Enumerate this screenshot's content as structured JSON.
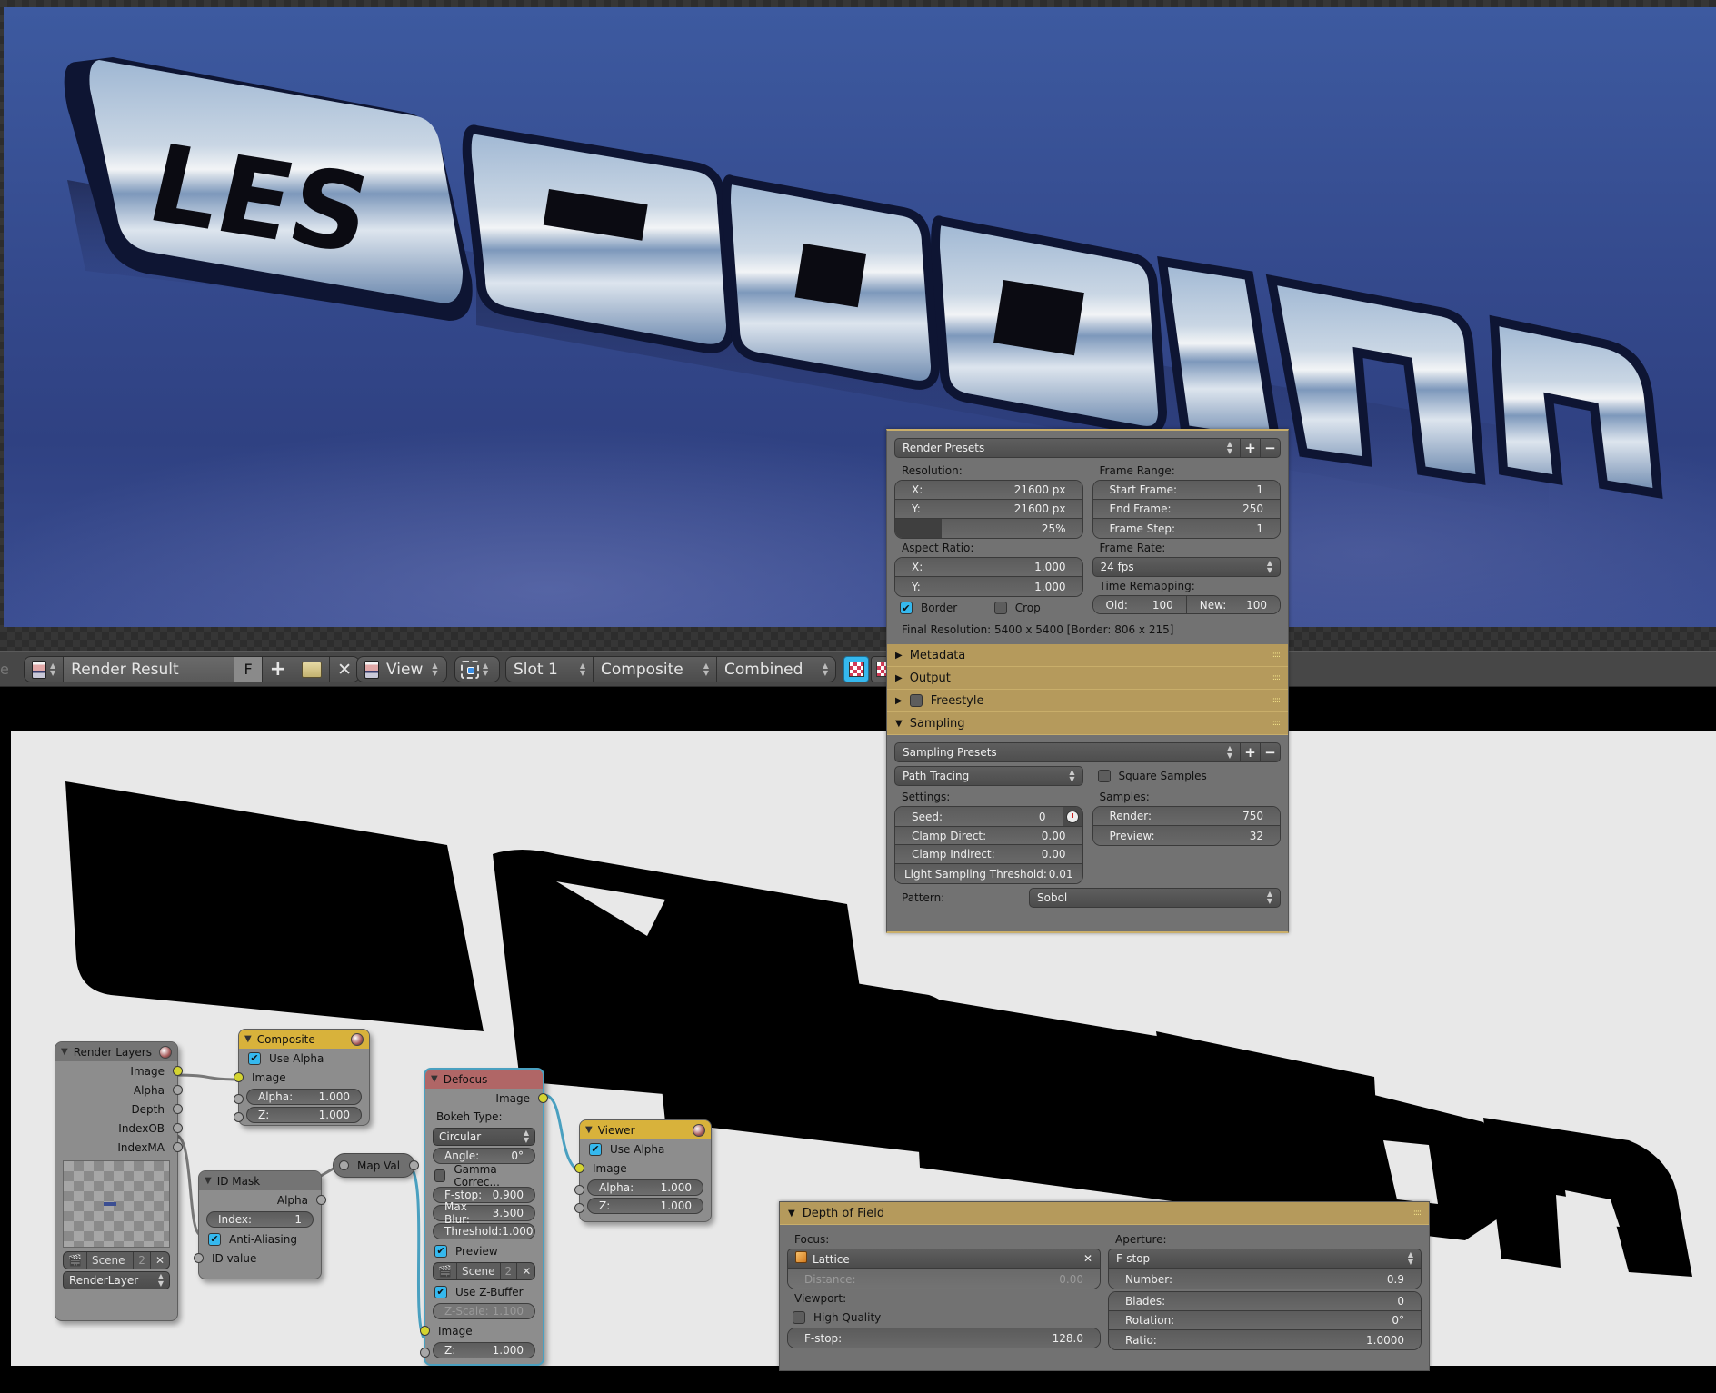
{
  "render_view": {
    "image_content": "LES GAGNON chrome 3D lettering on blue background",
    "text_depicted": "LES GAGNON"
  },
  "toolbar": {
    "cut_label": "e",
    "image_name": "Render Result",
    "fake_user": "F",
    "new_icon": "+",
    "open_icon": "open-folder",
    "close_icon": "✕",
    "view_menu": "View",
    "slot": "Slot 1",
    "layer": "Composite",
    "pass": "Combined",
    "up_down": [
      "▲",
      "▼"
    ]
  },
  "render_panel": {
    "presets_label": "Render Presets",
    "add": "+",
    "remove": "−",
    "resolution_label": "Resolution:",
    "res_x_label": "X:",
    "res_x_value": "21600 px",
    "res_y_label": "Y:",
    "res_y_value": "21600 px",
    "res_percent": "25%",
    "res_percent_fraction": 0.25,
    "aspect_label": "Aspect Ratio:",
    "aspect_x_label": "X:",
    "aspect_x_value": "1.000",
    "aspect_y_label": "Y:",
    "aspect_y_value": "1.000",
    "border_label": "Border",
    "border_checked": true,
    "crop_label": "Crop",
    "crop_checked": false,
    "frame_range_label": "Frame Range:",
    "start_frame_label": "Start Frame:",
    "start_frame_value": "1",
    "end_frame_label": "End Frame:",
    "end_frame_value": "250",
    "frame_step_label": "Frame Step:",
    "frame_step_value": "1",
    "frame_rate_label": "Frame Rate:",
    "frame_rate_value": "24 fps",
    "time_remap_label": "Time Remapping:",
    "old_label": "Old:",
    "old_value": "100",
    "new_label": "New:",
    "new_value": "100",
    "final_resolution": "Final Resolution: 5400 x 5400 [Border: 806 x 215]",
    "sections": [
      {
        "label": "Metadata",
        "expanded": false
      },
      {
        "label": "Output",
        "expanded": false
      },
      {
        "label": "Freestyle",
        "expanded": false,
        "has_checkbox": true
      },
      {
        "label": "Sampling",
        "expanded": true
      }
    ],
    "grip": "::::",
    "sampling": {
      "presets_label": "Sampling Presets",
      "integrator": "Path Tracing",
      "square_samples_label": "Square Samples",
      "square_samples_checked": false,
      "settings_label": "Settings:",
      "seed_label": "Seed:",
      "seed_value": "0",
      "clamp_direct_label": "Clamp Direct:",
      "clamp_direct_value": "0.00",
      "clamp_indirect_label": "Clamp Indirect:",
      "clamp_indirect_value": "0.00",
      "light_threshold_label": "Light Sampling Threshold:",
      "light_threshold_value": "0.01",
      "samples_label": "Samples:",
      "render_label": "Render:",
      "render_value": "750",
      "preview_label": "Preview:",
      "preview_value": "32",
      "pattern_label": "Pattern:",
      "pattern_value": "Sobol"
    }
  },
  "nodes": {
    "render_layers": {
      "title": "Render Layers",
      "outputs": [
        "Image",
        "Alpha",
        "Depth",
        "IndexOB",
        "IndexMA"
      ],
      "scene": "Scene",
      "scene_users": "2",
      "layer": "RenderLayer"
    },
    "composite": {
      "title": "Composite",
      "use_alpha_label": "Use Alpha",
      "use_alpha": true,
      "input_image": "Image",
      "alpha_label": "Alpha:",
      "alpha_value": "1.000",
      "z_label": "Z:",
      "z_value": "1.000"
    },
    "id_mask": {
      "title": "ID Mask",
      "output": "Alpha",
      "index_label": "Index:",
      "index_value": "1",
      "anti_aliasing_label": "Anti-Aliasing",
      "anti_aliasing": true,
      "input": "ID value"
    },
    "map_value": {
      "title": "Map Val"
    },
    "defocus": {
      "title": "Defocus",
      "output": "Image",
      "bokeh_label": "Bokeh Type:",
      "bokeh_value": "Circular",
      "angle_label": "Angle:",
      "angle_value": "0°",
      "gamma_label": "Gamma Correc...",
      "gamma": false,
      "fstop_label": "F-stop:",
      "fstop_value": "0.900",
      "maxblur_label": "Max Blur:",
      "maxblur_value": "3.500",
      "threshold_label": "Threshold:",
      "threshold_value": "1.000",
      "preview_label": "Preview",
      "preview": true,
      "scene": "Scene",
      "scene_users": "2",
      "use_zbuffer_label": "Use Z-Buffer",
      "use_zbuffer": true,
      "zscale_label": "Z-Scale:",
      "zscale_value": "1.100",
      "input_image": "Image",
      "z_label": "Z:",
      "z_value": "1.000"
    },
    "viewer": {
      "title": "Viewer",
      "use_alpha_label": "Use Alpha",
      "use_alpha": true,
      "input_image": "Image",
      "alpha_label": "Alpha:",
      "alpha_value": "1.000",
      "z_label": "Z:",
      "z_value": "1.000"
    }
  },
  "dof_panel": {
    "title": "Depth of Field",
    "focus_label": "Focus:",
    "focus_object": "Lattice",
    "clear_icon": "✕",
    "distance_label": "Distance:",
    "distance_value": "0.00",
    "viewport_label": "Viewport:",
    "high_quality_label": "High Quality",
    "high_quality": false,
    "vp_fstop_label": "F-stop:",
    "vp_fstop_value": "128.0",
    "aperture_label": "Aperture:",
    "aperture_type": "F-stop",
    "number_label": "Number:",
    "number_value": "0.9",
    "blades_label": "Blades:",
    "blades_value": "0",
    "rotation_label": "Rotation:",
    "rotation_value": "0°",
    "ratio_label": "Ratio:",
    "ratio_value": "1.0000"
  },
  "colors": {
    "panel_header": "#b59a5c",
    "checkbox_on": "#35b8ee",
    "node_header_output": "#d8b23b",
    "node_header_defocus": "#b06666",
    "socket_image": "#d4d430",
    "wire_selected": "#4aa0c0"
  }
}
